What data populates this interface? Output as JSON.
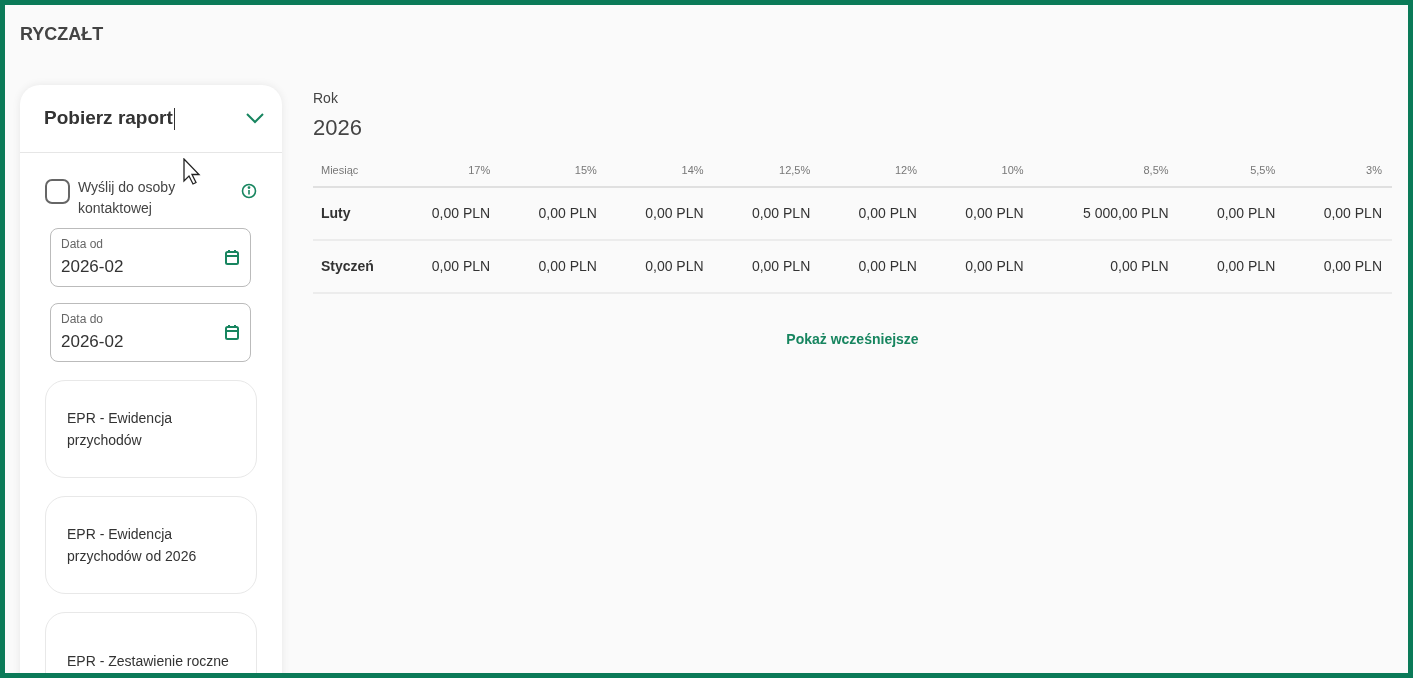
{
  "page": {
    "title": "RYCZAŁT"
  },
  "report_panel": {
    "title": "Pobierz raport",
    "expanded": true,
    "send_to_contact": {
      "label": "Wyślij do osoby kontaktowej",
      "checked": false
    },
    "date_fields": [
      {
        "label": "Data od",
        "value": "2026-02"
      },
      {
        "label": "Data do",
        "value": "2026-02"
      }
    ],
    "reports": [
      "EPR - Ewidencja przychodów",
      "EPR - Ewidencja przychodów od 2026",
      "EPR - Zestawienie roczne"
    ]
  },
  "year": {
    "label": "Rok",
    "value": "2026"
  },
  "table": {
    "columns": [
      "Miesiąc",
      "17%",
      "15%",
      "14%",
      "12,5%",
      "12%",
      "10%",
      "8,5%",
      "5,5%",
      "3%"
    ],
    "rows": [
      [
        "Luty",
        "0,00 PLN",
        "0,00 PLN",
        "0,00 PLN",
        "0,00 PLN",
        "0,00 PLN",
        "0,00 PLN",
        "5 000,00 PLN",
        "0,00 PLN",
        "0,00 PLN"
      ],
      [
        "Styczeń",
        "0,00 PLN",
        "0,00 PLN",
        "0,00 PLN",
        "0,00 PLN",
        "0,00 PLN",
        "0,00 PLN",
        "0,00 PLN",
        "0,00 PLN",
        "0,00 PLN"
      ]
    ]
  },
  "show_earlier": "Pokaż wcześniejsze"
}
